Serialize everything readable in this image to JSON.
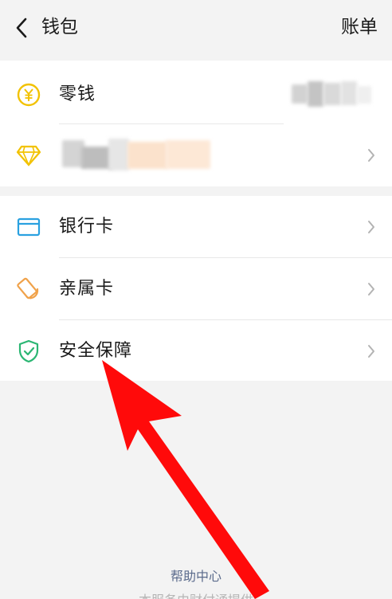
{
  "header": {
    "title": "钱包",
    "bill_label": "账单"
  },
  "wallet": {
    "balance_label": "零钱"
  },
  "services": [
    {
      "label": "银行卡",
      "icon": "bank-card-icon"
    },
    {
      "label": "亲属卡",
      "icon": "family-card-icon"
    },
    {
      "label": "安全保障",
      "icon": "shield-check-icon"
    }
  ],
  "footer": {
    "help_label": "帮助中心",
    "faded_text": "本服务由财付通提供"
  },
  "colors": {
    "background": "#f3f3f3",
    "coin_yellow": "#f2c200",
    "diamond_yellow": "#f2c200",
    "bank_blue": "#2aa1e0",
    "family_orange": "#f0a24a",
    "shield_green": "#2bb673",
    "help_link": "#5b6b8c",
    "annotation_red": "#ff0a0a"
  }
}
